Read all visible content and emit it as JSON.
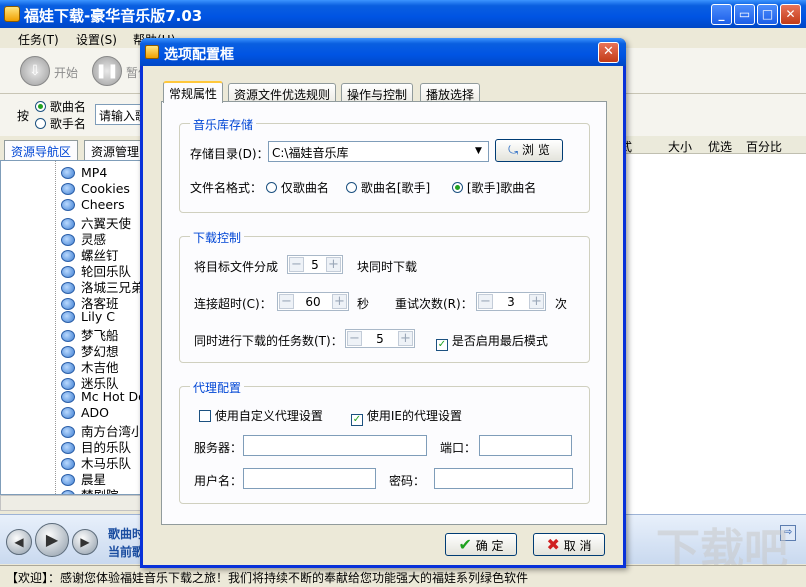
{
  "main_window": {
    "title": "福娃下载-豪华音乐版7.03",
    "menu": [
      "任务(T)",
      "设置(S)",
      "帮助(H)"
    ],
    "toolbar": {
      "start": "开始",
      "pause": "暂停"
    },
    "search": {
      "by_label": "按",
      "opt_song": "歌曲名",
      "opt_singer": "歌手名",
      "placeholder": "请输入歌"
    },
    "nav_tabs": [
      "资源导航区",
      "资源管理"
    ],
    "tree_items": [
      "MP4",
      "Cookies",
      "Cheers",
      "六翼天使",
      "灵感",
      "螺丝钉",
      "轮回乐队",
      "洛城三兄弟",
      "洛客班",
      "Lily C",
      "梦飞船",
      "梦幻想",
      "木吉他",
      "迷乐队",
      "Mc Hot Dog",
      "ADO",
      "南方台湾小",
      "目的乐队",
      "木马乐队",
      "晨星",
      "梦剧院"
    ],
    "list_columns": [
      "式",
      "大小",
      "优选",
      "百分比"
    ],
    "player": {
      "song_label": "歌曲时",
      "current_label": "当前歌"
    },
    "status": "【欢迎】：感谢您体验福娃音乐下载之旅！我们将持续不断的奉献给您功能强大的福娃系列绿色软件",
    "watermark": "下载吧"
  },
  "dialog": {
    "title": "选项配置框",
    "tabs": [
      "常规属性",
      "资源文件优选规则",
      "操作与控制",
      "播放选择"
    ],
    "active_tab": 0,
    "music_store": {
      "group_title": "音乐库存储",
      "dir_label": "存储目录(D)：",
      "dir_value": "C:\\福娃音乐库",
      "browse": "浏 览",
      "name_format_label": "文件名格式：",
      "formats": [
        "仅歌曲名",
        "歌曲名[歌手]",
        "[歌手]歌曲名"
      ],
      "selected_format": 2
    },
    "download": {
      "group_title": "下载控制",
      "split_label": "将目标文件分成",
      "split_value": "5",
      "split_suffix": "块同时下载",
      "timeout_label": "连接超时(C)：",
      "timeout_value": "60",
      "timeout_unit": "秒",
      "retry_label": "重试次数(R)：",
      "retry_value": "3",
      "retry_unit": "次",
      "tasks_label": "同时进行下载的任务数(T)：",
      "tasks_value": "5",
      "last_mode_label": "是否启用最后模式",
      "last_mode_checked": true
    },
    "proxy": {
      "group_title": "代理配置",
      "custom_label": "使用自定义代理设置",
      "custom_checked": false,
      "ie_label": "使用IE的代理设置",
      "ie_checked": true,
      "server_label": "服务器：",
      "port_label": "端口：",
      "user_label": "用户名：",
      "password_label": "密码：",
      "server_value": "",
      "port_value": "",
      "user_value": "",
      "password_value": ""
    },
    "ok": "确 定",
    "cancel": "取 消"
  }
}
